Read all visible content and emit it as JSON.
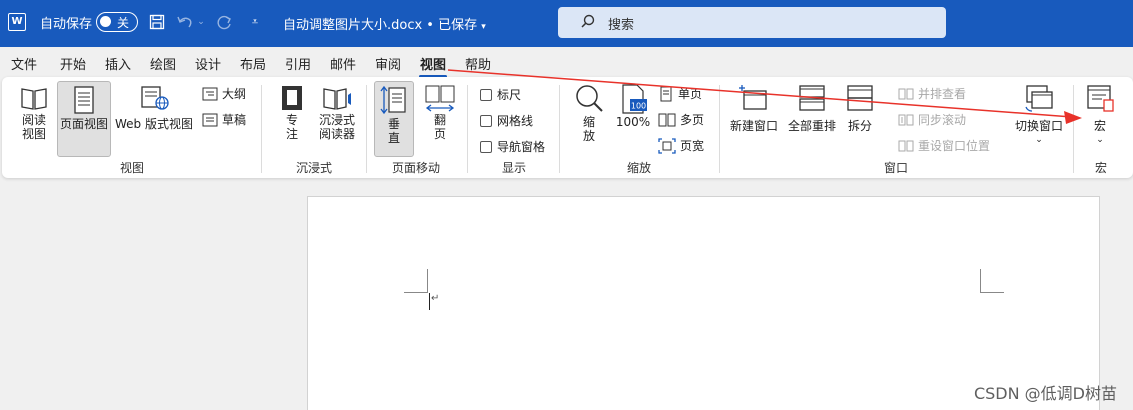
{
  "titlebar": {
    "app_icon": "W",
    "autosave_label": "自动保存",
    "autosave_state": "关",
    "doc_title": "自动调整图片大小.docx • 已保存",
    "search_label": "搜索"
  },
  "tabs": [
    "文件",
    "开始",
    "插入",
    "绘图",
    "设计",
    "布局",
    "引用",
    "邮件",
    "审阅",
    "视图",
    "帮助"
  ],
  "active_tab": "视图",
  "ribbon": {
    "views": {
      "read_mode": [
        "阅读",
        "视图"
      ],
      "print_layout": "页面视图",
      "web_layout": "Web 版式视图",
      "outline": "大纲",
      "draft": "草稿",
      "group": "视图"
    },
    "immersive": {
      "focus": [
        "专",
        "注"
      ],
      "reader": [
        "沉浸式",
        "阅读器"
      ],
      "group": "沉浸式"
    },
    "page_movement": {
      "vertical": [
        "垂",
        "直"
      ],
      "side_to_side": [
        "翻",
        "页"
      ],
      "group": "页面移动"
    },
    "show": {
      "ruler": "标尺",
      "gridlines": "网格线",
      "nav_pane": "导航窗格",
      "group": "显示"
    },
    "zoom": {
      "zoom": [
        "缩",
        "放"
      ],
      "hundred": "100%",
      "hundred_icon_text": "100",
      "one_page": "单页",
      "multi_page": "多页",
      "page_width": "页宽",
      "group": "缩放"
    },
    "window": {
      "new_window": "新建窗口",
      "arrange_all": "全部重排",
      "split": "拆分",
      "side_by_side": "并排查看",
      "sync_scroll": "同步滚动",
      "reset_position": "重设窗口位置",
      "switch_windows": "切换窗口",
      "group": "窗口"
    },
    "macros": {
      "macros": "宏",
      "group": "宏"
    }
  },
  "watermark": "CSDN @低调D树苗",
  "colors": {
    "brand": "#185abd",
    "annotation_arrow": "#e8322a"
  }
}
